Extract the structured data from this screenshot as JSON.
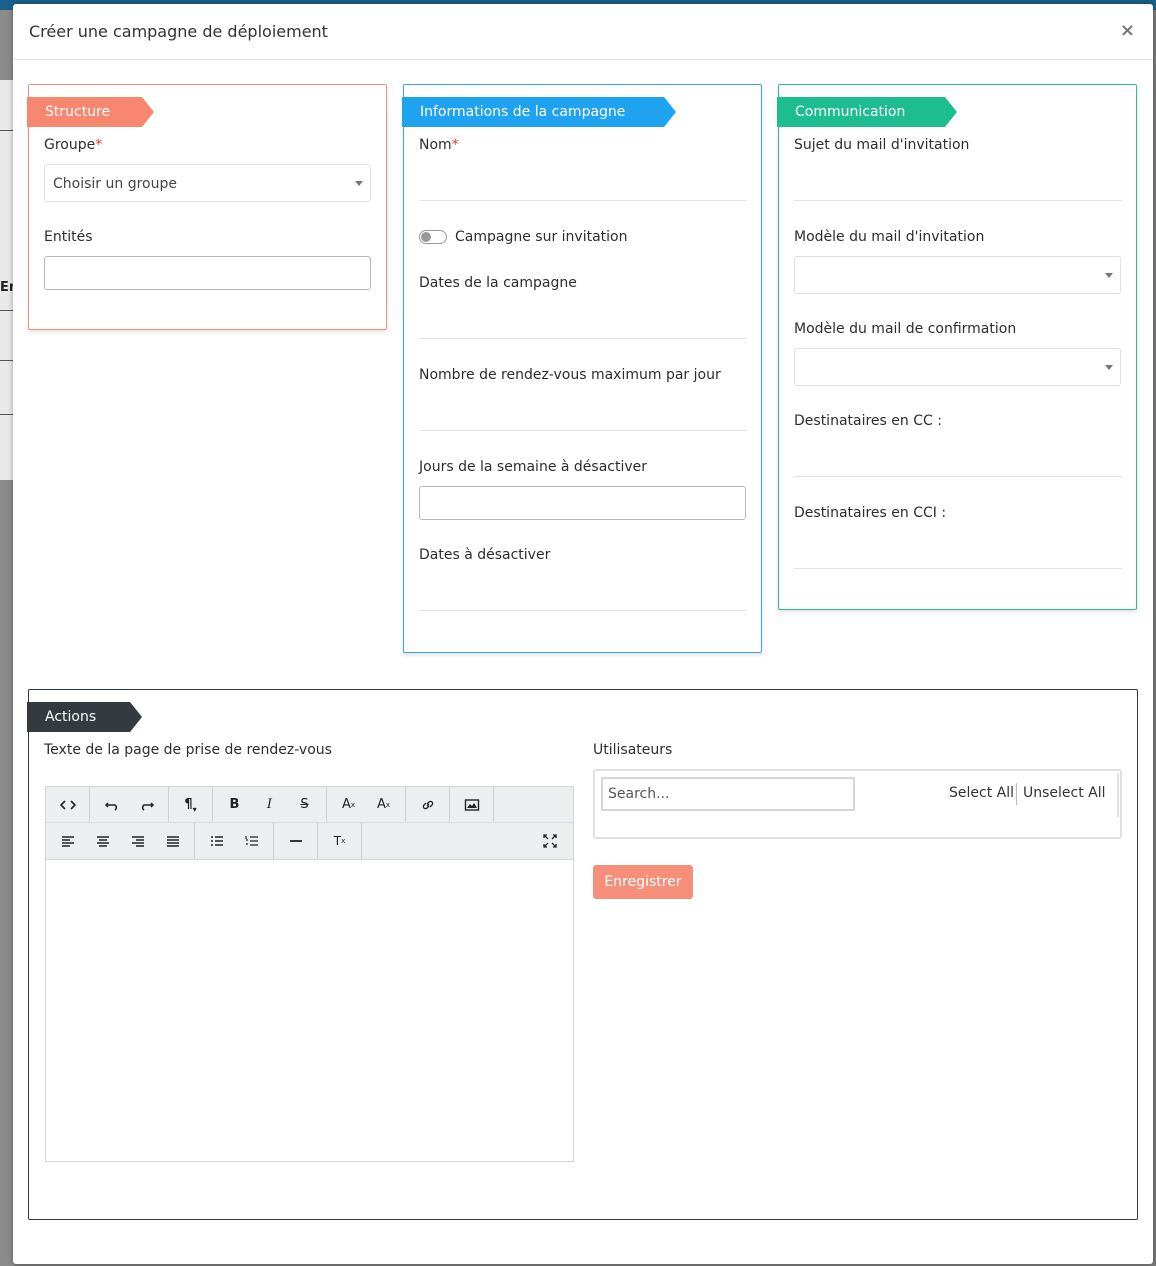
{
  "modal": {
    "title": "Créer une campagne de déploiement",
    "close_label": "×"
  },
  "background": {
    "partial_text": "En"
  },
  "structure": {
    "ribbon": "Structure",
    "groupe_label": "Groupe",
    "groupe_select": "Choisir un groupe",
    "entites_label": "Entités",
    "colors": {
      "accent": "#f8876f",
      "border": "#f3907b"
    }
  },
  "campaign": {
    "ribbon": "Informations de la campagne",
    "nom_label": "Nom",
    "toggle_label": "Campagne sur invitation",
    "dates_label": "Dates de la campagne",
    "max_rdv_label": "Nombre de rendez-vous maximum par jour",
    "jours_label": "Jours de la semaine à désactiver",
    "dates_desactiver_label": "Dates à désactiver",
    "colors": {
      "accent": "#1fa3f0",
      "border": "#3aa6e8"
    }
  },
  "communication": {
    "ribbon": "Communication",
    "sujet_label": "Sujet du mail d'invitation",
    "modele_invitation_label": "Modèle du mail d'invitation",
    "modele_confirmation_label": "Modèle du mail de confirmation",
    "cc_label": "Destinataires en CC :",
    "cci_label": "Destinataires en CCI :",
    "colors": {
      "accent": "#1dbd8f",
      "border": "#2bbd93"
    }
  },
  "actions": {
    "ribbon": "Actions",
    "text_label": "Texte de la page de prise de rendez-vous",
    "users_label": "Utilisateurs",
    "search_placeholder": "Search...",
    "select_all": "Select All",
    "unselect_all": "Unselect All",
    "save_button": "Enregistrer",
    "colors": {
      "accent": "#343a40",
      "save": "#f58f79"
    }
  },
  "editor_toolbar": {
    "row1": [
      "code-view-icon",
      "undo-icon",
      "redo-icon",
      "paragraph-icon",
      "bold-icon",
      "italic-icon",
      "strikethrough-icon",
      "superscript-icon",
      "subscript-icon",
      "link-icon",
      "image-icon"
    ],
    "row2": [
      "align-left-icon",
      "align-center-icon",
      "align-right-icon",
      "align-justify-icon",
      "unordered-list-icon",
      "ordered-list-icon",
      "horizontal-rule-icon",
      "clear-format-icon",
      "fullscreen-icon"
    ]
  }
}
